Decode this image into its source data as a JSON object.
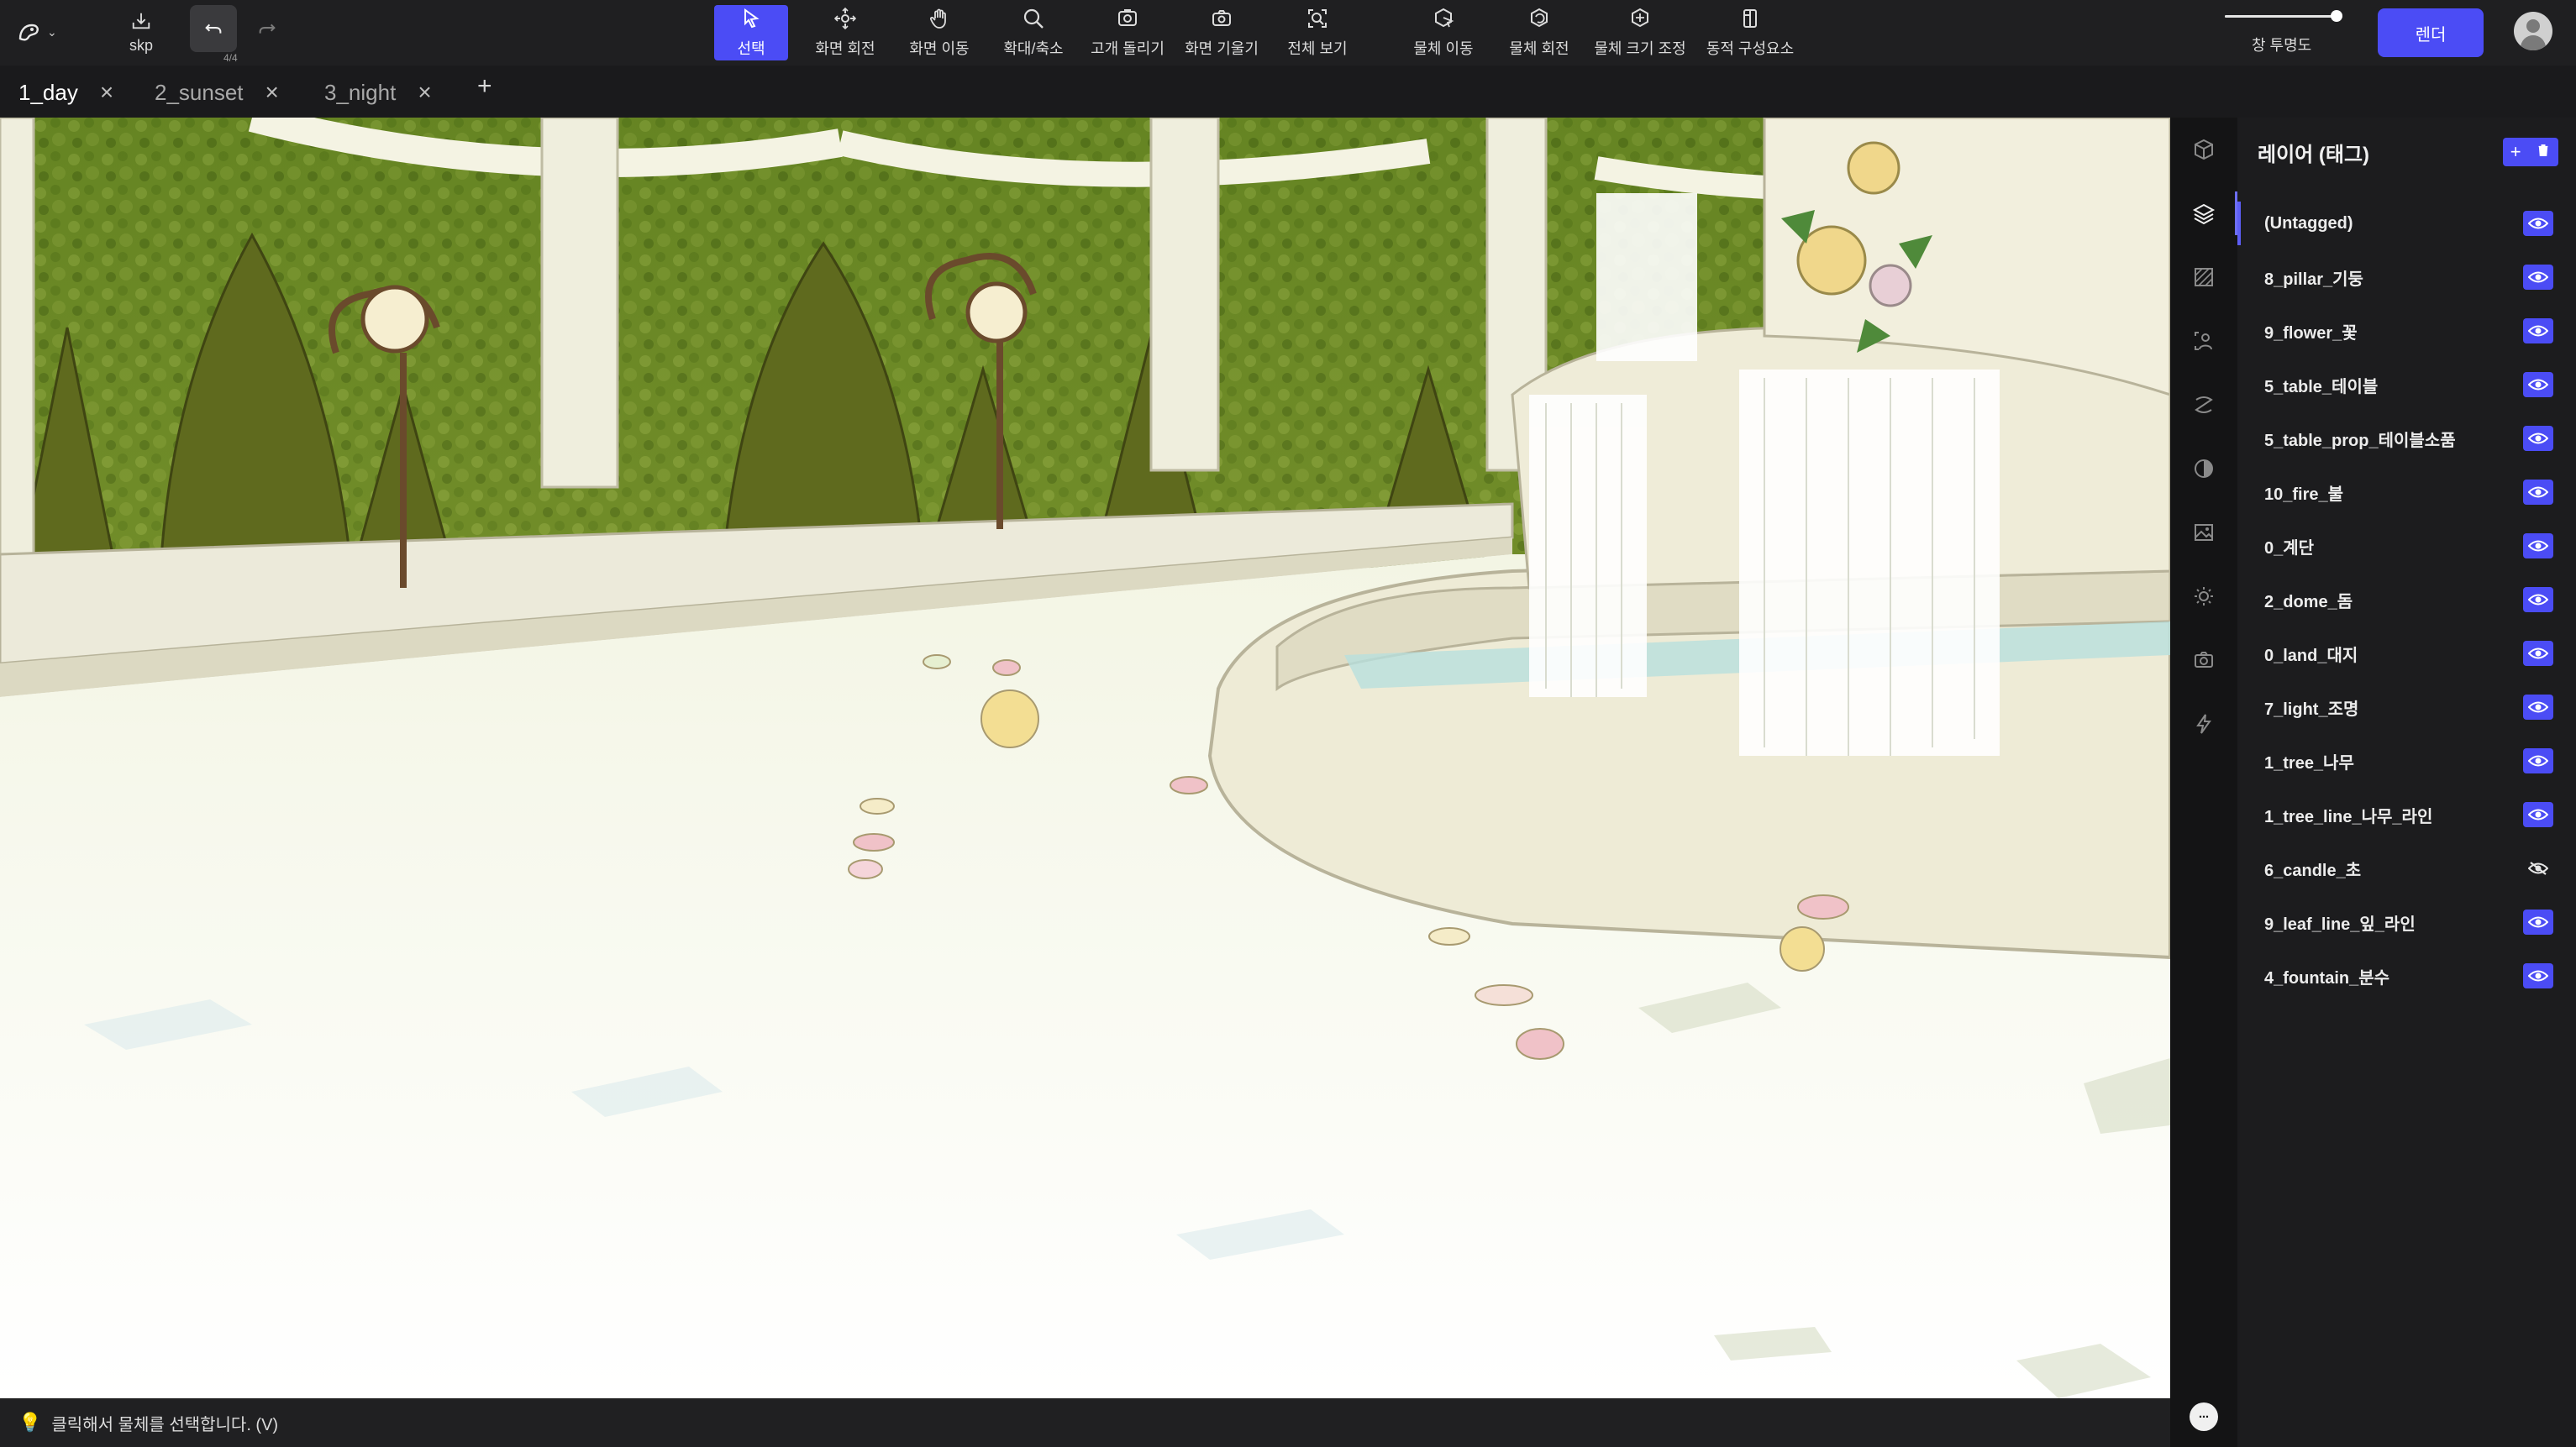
{
  "toolbar": {
    "file_label": "skp",
    "undo_counter": "4/4",
    "tools": [
      {
        "label": "선택",
        "icon": "cursor-arrow-icon",
        "active": true
      },
      {
        "label": "화면 회전",
        "icon": "orbit-icon"
      },
      {
        "label": "화면 이동",
        "icon": "hand-pan-icon"
      },
      {
        "label": "확대/축소",
        "icon": "magnifier-icon"
      },
      {
        "label": "고개 돌리기",
        "icon": "look-around-icon"
      },
      {
        "label": "화면 기울기",
        "icon": "camera-tilt-icon"
      },
      {
        "label": "전체 보기",
        "icon": "zoom-extents-icon"
      },
      {
        "label": "물체 이동",
        "icon": "object-move-icon"
      },
      {
        "label": "물체 회전",
        "icon": "object-rotate-icon"
      },
      {
        "label": "물체 크기 조정",
        "icon": "object-scale-icon"
      },
      {
        "label": "동적 구성요소",
        "icon": "dynamic-component-icon"
      }
    ],
    "opacity_label": "창 투명도",
    "opacity_value": 0.95,
    "render_label": "렌더"
  },
  "tabs": [
    {
      "label": "1_day",
      "active": true
    },
    {
      "label": "2_sunset",
      "active": false
    },
    {
      "label": "3_night",
      "active": false
    }
  ],
  "tab_add_label": "+",
  "status": {
    "icon": "lightbulb-icon",
    "text": "클릭해서 물체를 선택합니다. (V)"
  },
  "rail": [
    {
      "icon": "cube-icon"
    },
    {
      "icon": "layers-icon",
      "active": true
    },
    {
      "icon": "material-hatch-icon"
    },
    {
      "icon": "person-frame-icon"
    },
    {
      "icon": "line-style-icon"
    },
    {
      "icon": "shading-icon"
    },
    {
      "icon": "image-icon"
    },
    {
      "icon": "sun-icon"
    },
    {
      "icon": "camera-icon"
    },
    {
      "icon": "lightning-icon"
    }
  ],
  "panel": {
    "title": "레이어 (태그)",
    "add_label": "+",
    "delete_icon": "trash-icon",
    "layers": [
      {
        "name": "(Untagged)",
        "visible": true,
        "active": true
      },
      {
        "name": "8_pillar_기둥",
        "visible": true
      },
      {
        "name": "9_flower_꽃",
        "visible": true
      },
      {
        "name": "5_table_테이블",
        "visible": true
      },
      {
        "name": "5_table_prop_테이블소품",
        "visible": true
      },
      {
        "name": "10_fire_불",
        "visible": true
      },
      {
        "name": "0_계단",
        "visible": true
      },
      {
        "name": "2_dome_돔",
        "visible": true
      },
      {
        "name": "0_land_대지",
        "visible": true
      },
      {
        "name": "7_light_조명",
        "visible": true
      },
      {
        "name": "1_tree_나무",
        "visible": true
      },
      {
        "name": "1_tree_line_나무_라인",
        "visible": true
      },
      {
        "name": "6_candle_초",
        "visible": false
      },
      {
        "name": "9_leaf_line_잎_라인",
        "visible": true
      },
      {
        "name": "4_fountain_분수",
        "visible": true
      }
    ]
  }
}
